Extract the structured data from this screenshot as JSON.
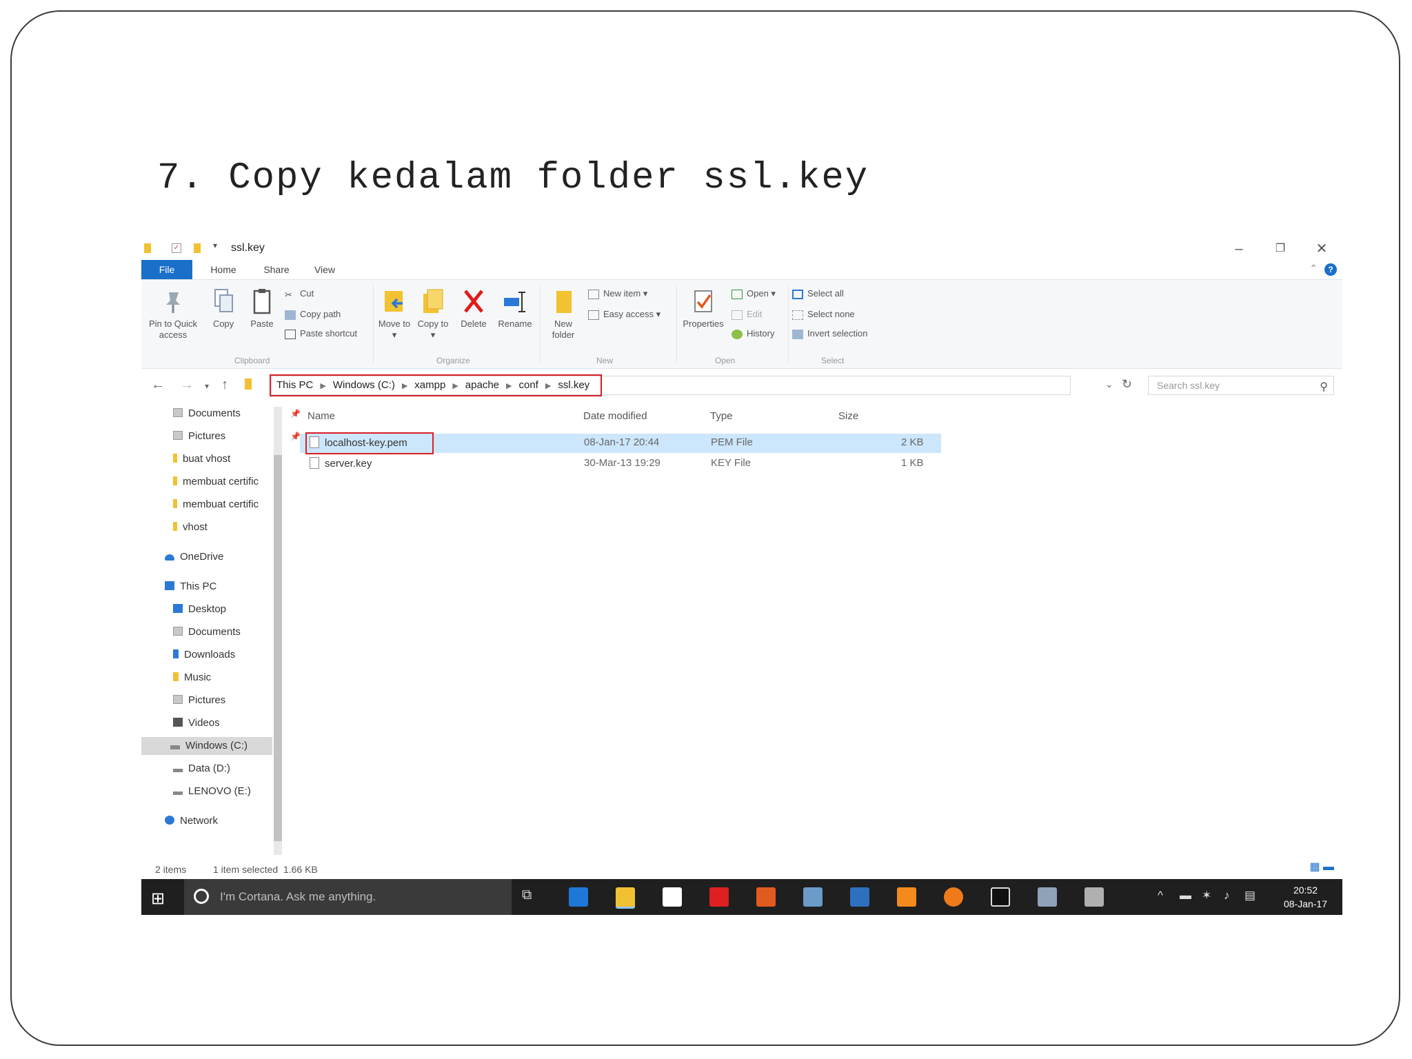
{
  "slide": {
    "title": "7. Copy kedalam folder ssl.key"
  },
  "window": {
    "title": "ssl.key",
    "controls": {
      "minimize": "–",
      "maximize": "❐",
      "close": "✕"
    }
  },
  "ribbon": {
    "tabs": [
      "File",
      "Home",
      "Share",
      "View"
    ],
    "help": "?",
    "clipboard": {
      "pin": "Pin to Quick access",
      "copy": "Copy",
      "paste": "Paste",
      "cut": "Cut",
      "copy_path": "Copy path",
      "paste_shortcut": "Paste shortcut",
      "label": "Clipboard"
    },
    "organize": {
      "move_to": "Move to ▾",
      "copy_to": "Copy to ▾",
      "delete": "Delete",
      "rename": "Rename",
      "label": "Organize"
    },
    "new": {
      "new_folder": "New folder",
      "new_item": "New item ▾",
      "easy_access": "Easy access ▾",
      "label": "New"
    },
    "open": {
      "properties": "Properties",
      "open": "Open ▾",
      "edit": "Edit",
      "history": "History",
      "label": "Open"
    },
    "select": {
      "select_all": "Select all",
      "select_none": "Select none",
      "invert": "Invert selection",
      "label": "Select"
    }
  },
  "address": {
    "breadcrumbs": [
      "This PC",
      "Windows (C:)",
      "xampp",
      "apache",
      "conf",
      "ssl.key"
    ],
    "search_placeholder": "Search ssl.key"
  },
  "nav_pane": {
    "items": [
      {
        "label": "Documents",
        "pinned": "📌"
      },
      {
        "label": "Pictures",
        "pinned": "📌"
      },
      {
        "label": "buat vhost"
      },
      {
        "label": "membuat certific"
      },
      {
        "label": "membuat certific"
      },
      {
        "label": "vhost"
      },
      {
        "label": "OneDrive"
      },
      {
        "label": "This PC"
      },
      {
        "label": "Desktop"
      },
      {
        "label": "Documents"
      },
      {
        "label": "Downloads"
      },
      {
        "label": "Music"
      },
      {
        "label": "Pictures"
      },
      {
        "label": "Videos"
      },
      {
        "label": "Windows (C:)"
      },
      {
        "label": "Data (D:)"
      },
      {
        "label": "LENOVO (E:)"
      },
      {
        "label": "Network"
      }
    ]
  },
  "file_list": {
    "columns": [
      "Name",
      "Date modified",
      "Type",
      "Size"
    ],
    "rows": [
      {
        "name": "localhost-key.pem",
        "date": "08-Jan-17 20:44",
        "type": "PEM File",
        "size": "2 KB"
      },
      {
        "name": "server.key",
        "date": "30-Mar-13 19:29",
        "type": "KEY File",
        "size": "1 KB"
      }
    ]
  },
  "status": {
    "items": "2 items",
    "selected": "1 item selected  1.66 KB"
  },
  "taskbar": {
    "cortana": "I'm Cortana. Ask me anything.",
    "time": "20:52",
    "date": "08-Jan-17"
  }
}
